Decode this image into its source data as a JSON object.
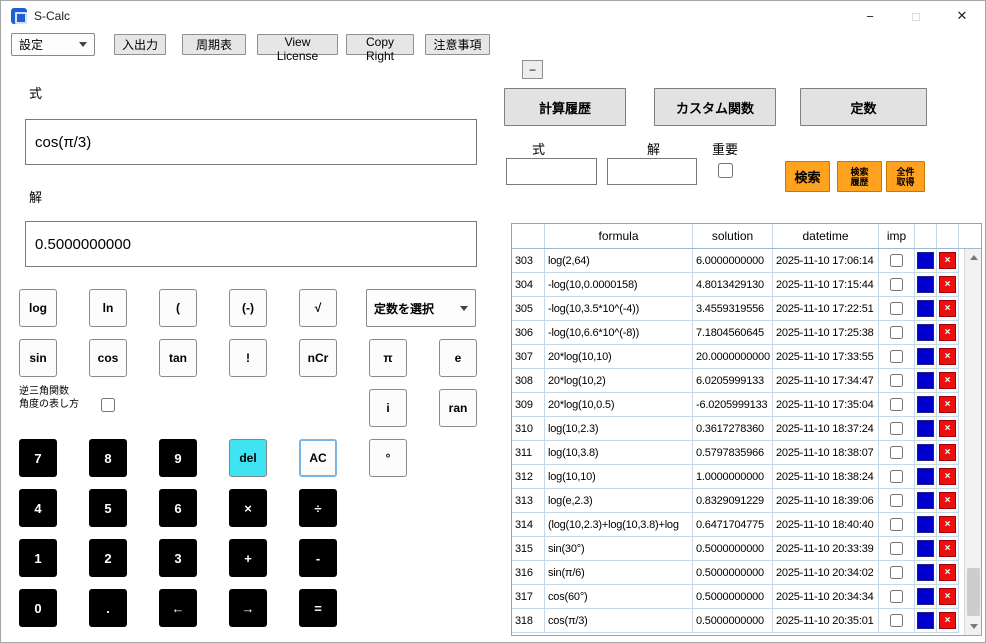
{
  "window": {
    "title": "S-Calc",
    "minimize_label": "−",
    "maximize_label": "□",
    "close_label": "✕"
  },
  "menubar": {
    "settings_label": "設定",
    "io_label": "入出力",
    "periodic_label": "周期表",
    "license_label": "View License",
    "copyright_label": "Copy Right",
    "notes_label": "注意事項"
  },
  "calc": {
    "formula_label": "式",
    "formula_value": "cos(π/3)",
    "solution_label": "解",
    "solution_value": "0.5000000000",
    "constant_select_label": "定数を選択",
    "inverse_trig_line1": "逆三角関数",
    "inverse_trig_line2": "角度の表し方",
    "keys": {
      "log": "log",
      "ln": "ln",
      "lparen": "(",
      "neg": "(-)",
      "sqrt": "√",
      "sin": "sin",
      "cos": "cos",
      "tan": "tan",
      "fact": "!",
      "ncr": "nCr",
      "pi": "π",
      "e": "e",
      "i": "i",
      "ran": "ran",
      "deg": "°",
      "k7": "7",
      "k8": "8",
      "k9": "9",
      "del": "del",
      "ac": "AC",
      "k4": "4",
      "k5": "5",
      "k6": "6",
      "mul": "×",
      "div": "÷",
      "k1": "1",
      "k2": "2",
      "k3": "3",
      "add": "+",
      "sub": "-",
      "k0": "0",
      "dot": ".",
      "left": "←",
      "right": "→",
      "eq": "="
    }
  },
  "panel": {
    "collapse_label": "−",
    "history_button": "計算履歴",
    "custom_button": "カスタム関数",
    "constants_button": "定数",
    "search_formula_label": "式",
    "search_solution_label": "解",
    "important_label": "重要",
    "search_button": "検索",
    "search_history_line1": "検索",
    "search_history_line2": "履歴",
    "get_all_line1": "全件",
    "get_all_line2": "取得"
  },
  "colors": {
    "accent_orange": "#ffa21f",
    "row_blue": "#0000cd",
    "row_red": "#ec0f0f",
    "del_cyan": "#3fe3f2"
  },
  "table": {
    "headers": {
      "formula": "formula",
      "solution": "solution",
      "datetime": "datetime",
      "imp": "imp"
    },
    "delete_glyph": "×",
    "rows": [
      {
        "num": "303",
        "formula": "log(2,64)",
        "solution": "6.0000000000",
        "datetime": "2025-11-10 17:06:14"
      },
      {
        "num": "304",
        "formula": "-log(10,0.0000158)",
        "solution": "4.8013429130",
        "datetime": "2025-11-10 17:15:44"
      },
      {
        "num": "305",
        "formula": "-log(10,3.5*10^(-4))",
        "solution": "3.4559319556",
        "datetime": "2025-11-10 17:22:51"
      },
      {
        "num": "306",
        "formula": "-log(10,6.6*10^(-8))",
        "solution": "7.1804560645",
        "datetime": "2025-11-10 17:25:38"
      },
      {
        "num": "307",
        "formula": "20*log(10,10)",
        "solution": "20.0000000000",
        "datetime": "2025-11-10 17:33:55"
      },
      {
        "num": "308",
        "formula": "20*log(10,2)",
        "solution": "6.0205999133",
        "datetime": "2025-11-10 17:34:47"
      },
      {
        "num": "309",
        "formula": "20*log(10,0.5)",
        "solution": "-6.0205999133",
        "datetime": "2025-11-10 17:35:04"
      },
      {
        "num": "310",
        "formula": "log(10,2.3)",
        "solution": "0.3617278360",
        "datetime": "2025-11-10 18:37:24"
      },
      {
        "num": "311",
        "formula": "log(10,3.8)",
        "solution": "0.5797835966",
        "datetime": "2025-11-10 18:38:07"
      },
      {
        "num": "312",
        "formula": "log(10,10)",
        "solution": "1.0000000000",
        "datetime": "2025-11-10 18:38:24"
      },
      {
        "num": "313",
        "formula": "log(e,2.3)",
        "solution": "0.8329091229",
        "datetime": "2025-11-10 18:39:06"
      },
      {
        "num": "314",
        "formula": "(log(10,2.3)+log(10,3.8)+log",
        "solution": "0.6471704775",
        "datetime": "2025-11-10 18:40:40"
      },
      {
        "num": "315",
        "formula": "sin(30°)",
        "solution": "0.5000000000",
        "datetime": "2025-11-10 20:33:39"
      },
      {
        "num": "316",
        "formula": "sin(π/6)",
        "solution": "0.5000000000",
        "datetime": "2025-11-10 20:34:02"
      },
      {
        "num": "317",
        "formula": "cos(60°)",
        "solution": "0.5000000000",
        "datetime": "2025-11-10 20:34:34"
      },
      {
        "num": "318",
        "formula": "cos(π/3)",
        "solution": "0.5000000000",
        "datetime": "2025-11-10 20:35:01"
      }
    ]
  }
}
